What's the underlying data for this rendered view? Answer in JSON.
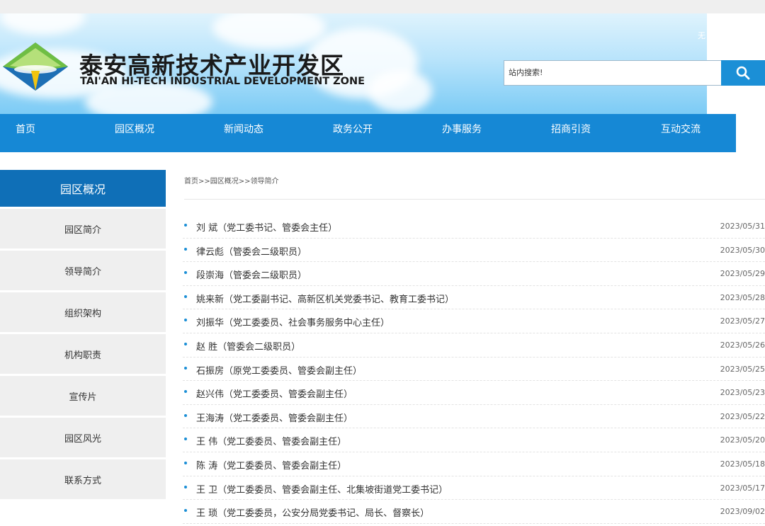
{
  "header": {
    "title_cn": "泰安高新技术产业开发区",
    "title_en": "TAI'AN HI-TECH INDUSTRIAL DEVELOPMENT ZONE",
    "top_link": "无"
  },
  "search": {
    "placeholder": "站内搜索!",
    "button_icon": "search-icon"
  },
  "nav": {
    "items": [
      "首页",
      "园区概况",
      "新闻动态",
      "政务公开",
      "办事服务",
      "招商引资",
      "互动交流"
    ]
  },
  "sidebar": {
    "title": "园区概况",
    "items": [
      "园区简介",
      "领导简介",
      "组织架构",
      "机构职责",
      "宣传片",
      "园区风光",
      "联系方式"
    ]
  },
  "breadcrumb": "首页>>园区概况>>领导简介",
  "list": [
    {
      "title": "刘 斌（党工委书记、管委会主任）",
      "date": "2023/05/31"
    },
    {
      "title": "律云彪（管委会二级职员）",
      "date": "2023/05/30"
    },
    {
      "title": "段崇海（管委会二级职员）",
      "date": "2023/05/29"
    },
    {
      "title": "姚来新（党工委副书记、高新区机关党委书记、教育工委书记）",
      "date": "2023/05/28"
    },
    {
      "title": "刘振华（党工委委员、社会事务服务中心主任）",
      "date": "2023/05/27"
    },
    {
      "title": "赵 胜（管委会二级职员）",
      "date": "2023/05/26"
    },
    {
      "title": "石振房（原党工委委员、管委会副主任）",
      "date": "2023/05/25"
    },
    {
      "title": "赵兴伟（党工委委员、管委会副主任）",
      "date": "2023/05/23"
    },
    {
      "title": "王海涛（党工委委员、管委会副主任）",
      "date": "2023/05/22"
    },
    {
      "title": "王 伟（党工委委员、管委会副主任）",
      "date": "2023/05/20"
    },
    {
      "title": "陈 涛（党工委委员、管委会副主任）",
      "date": "2023/05/18"
    },
    {
      "title": "王 卫（党工委委员、管委会副主任、北集坡街道党工委书记）",
      "date": "2023/05/17"
    },
    {
      "title": "王 琐（党工委委员，公安分局党委书记、局长、督察长）",
      "date": "2023/09/02"
    }
  ],
  "colors": {
    "nav_blue": "#1688d5",
    "sidebar_head": "#0f6fb7",
    "search_button": "#1b8fd6"
  }
}
